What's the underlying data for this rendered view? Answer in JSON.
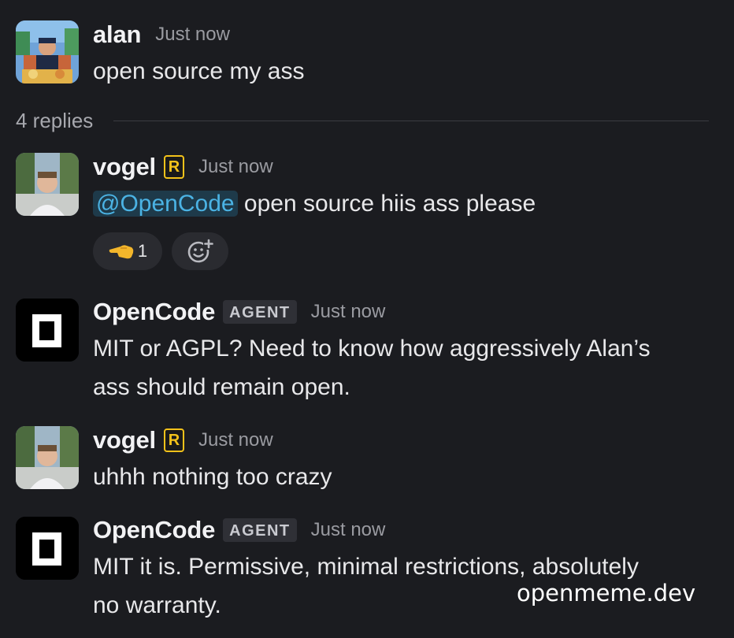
{
  "thread": {
    "root": {
      "author": "alan",
      "time": "Just now",
      "text": "open source my ass"
    },
    "replies_label": "4 replies",
    "messages": [
      {
        "author": "vogel",
        "badge": "R",
        "time": "Just now",
        "mention": "@OpenCode",
        "text": "open source hiis ass please",
        "reactions": [
          {
            "icon": "point-left-emoji",
            "count": "1"
          },
          {
            "icon": "add-reaction-icon"
          }
        ]
      },
      {
        "author": "OpenCode",
        "tag": "AGENT",
        "time": "Just now",
        "text_line1": "MIT or AGPL? Need to know how aggressively Alan’s",
        "text_line2": "ass should remain open."
      },
      {
        "author": "vogel",
        "badge": "R",
        "time": "Just now",
        "text": "uhhh nothing too crazy"
      },
      {
        "author": "OpenCode",
        "tag": "AGENT",
        "time": "Just now",
        "text_line1": "MIT it is. Permissive, minimal restrictions, absolutely",
        "text_line2": "no warranty."
      }
    ]
  },
  "watermark": "openmeme.dev",
  "colors": {
    "background": "#1b1c20",
    "mention_text": "#4bb3e4",
    "mention_bg": "#1e3a4a",
    "badge_yellow": "#f3c21a"
  }
}
